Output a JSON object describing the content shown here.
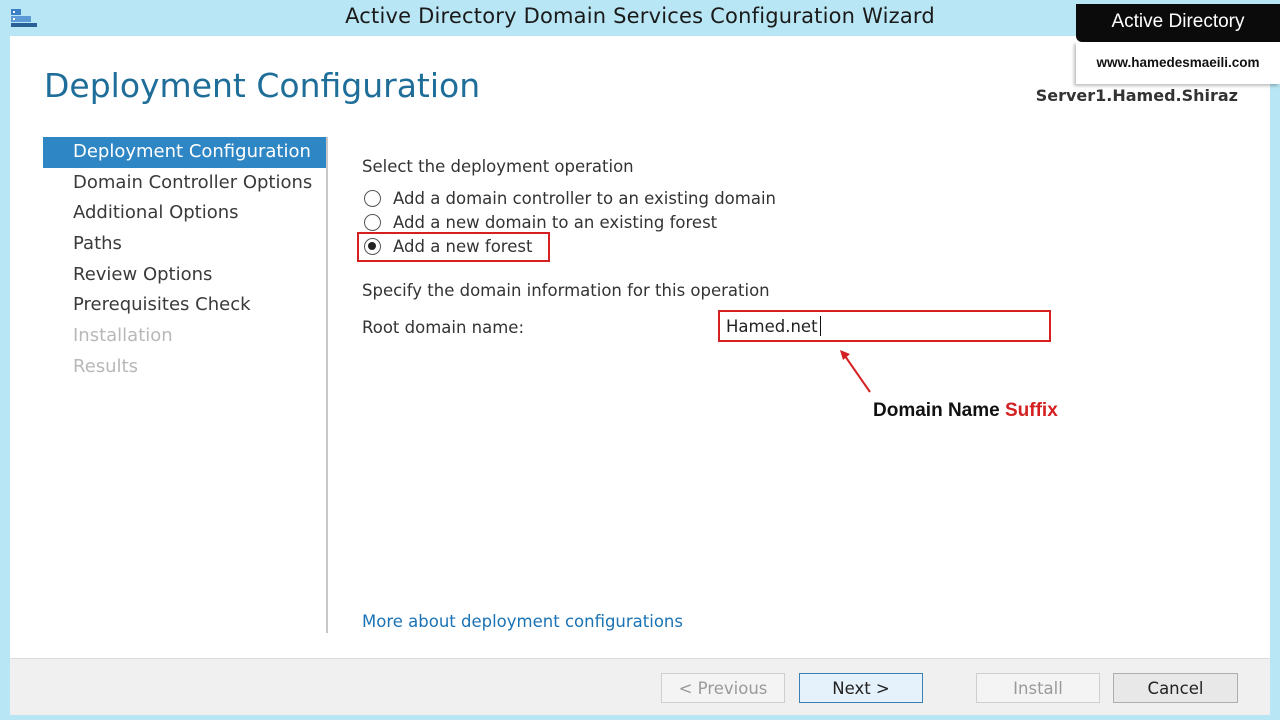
{
  "window": {
    "title": "Active Directory Domain Services Configuration Wizard",
    "icon": "server-manager-icon"
  },
  "header": {
    "page_title": "Deployment Configuration",
    "server_name": "Server1.Hamed.Shiraz"
  },
  "nav": {
    "items": [
      {
        "label": "Deployment Configuration",
        "state": "active"
      },
      {
        "label": "Domain Controller Options",
        "state": "normal"
      },
      {
        "label": "Additional Options",
        "state": "normal"
      },
      {
        "label": "Paths",
        "state": "normal"
      },
      {
        "label": "Review Options",
        "state": "normal"
      },
      {
        "label": "Prerequisites Check",
        "state": "normal"
      },
      {
        "label": "Installation",
        "state": "disabled"
      },
      {
        "label": "Results",
        "state": "disabled"
      }
    ]
  },
  "main": {
    "operation_heading": "Select the deployment operation",
    "options": [
      {
        "label": "Add a domain controller to an existing domain",
        "checked": false
      },
      {
        "label": "Add a new domain to an existing forest",
        "checked": false
      },
      {
        "label": "Add a new forest",
        "checked": true
      }
    ],
    "domain_heading": "Specify the domain information for this operation",
    "root_domain_label": "Root domain name:",
    "root_domain_value": "Hamed.net",
    "annotation_text": "Domain Name ",
    "annotation_accent": "Suffix",
    "more_link": "More about deployment configurations"
  },
  "footer": {
    "previous": "< Previous",
    "next": "Next >",
    "install": "Install",
    "cancel": "Cancel"
  },
  "watermark": {
    "title": "Active Directory",
    "url": "www.hamedesmaeili.com"
  },
  "colors": {
    "accent": "#2e86c5",
    "highlight": "#d42020",
    "title": "#1f6e9a",
    "frame": "#b9e6f4"
  }
}
